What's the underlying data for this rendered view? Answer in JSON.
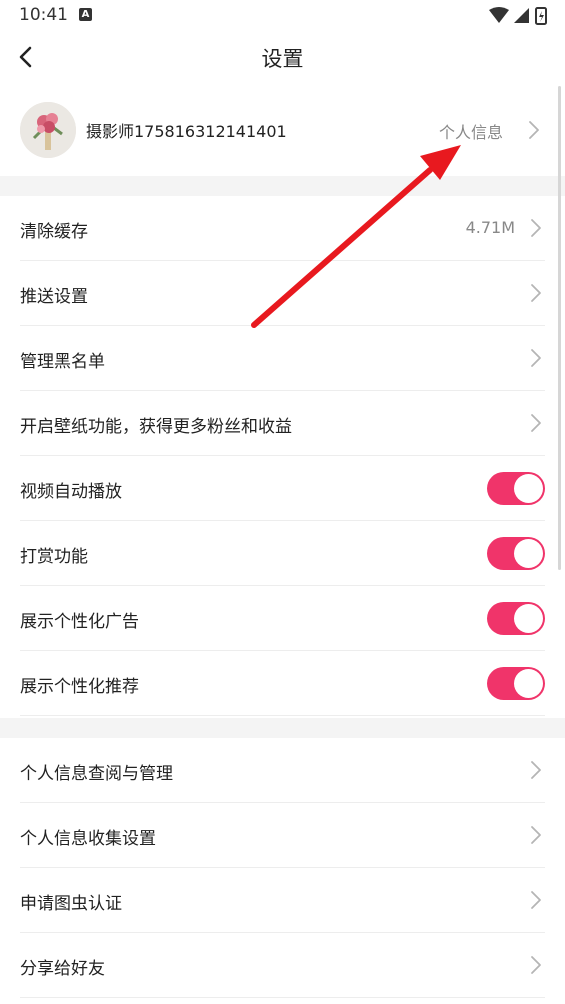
{
  "status_bar": {
    "time": "10:41",
    "icons": [
      "a-icon",
      "wifi-icon",
      "signal-icon",
      "battery-icon"
    ]
  },
  "header": {
    "title": "设置",
    "back_icon": "chevron-left-icon"
  },
  "profile": {
    "username": "摄影师175816312141401",
    "link_label": "个人信息"
  },
  "settings": {
    "items": [
      {
        "label": "清除缓存",
        "value": "4.71M"
      },
      {
        "label": "推送设置"
      },
      {
        "label": "管理黑名单"
      },
      {
        "label": "开启壁纸功能，获得更多粉丝和收益"
      }
    ],
    "toggles": [
      {
        "label": "视频自动播放",
        "on": true
      },
      {
        "label": "打赏功能",
        "on": true
      },
      {
        "label": "展示个性化广告",
        "on": true
      },
      {
        "label": "展示个性化推荐",
        "on": true
      }
    ]
  },
  "info": {
    "items": [
      {
        "label": "个人信息查阅与管理"
      },
      {
        "label": "个人信息收集设置"
      },
      {
        "label": "申请图虫认证"
      },
      {
        "label": "分享给好友"
      }
    ]
  },
  "colors": {
    "accent": "#f0346a",
    "arrow": "#e8191f",
    "divider": "#ededed",
    "section_bg": "#f4f4f4"
  }
}
